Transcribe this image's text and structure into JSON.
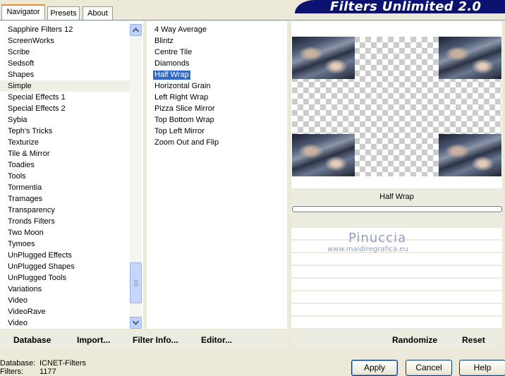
{
  "tabs": [
    "Navigator",
    "Presets",
    "About"
  ],
  "banner_title": "Filters Unlimited 2.0",
  "categories": [
    "Sapphire Filters 12",
    "ScreenWorks",
    "Scribe",
    "Sedsoft",
    "Shapes",
    "Simple",
    "Special Effects 1",
    "Special Effects 2",
    "Sybia",
    "Teph's Tricks",
    "Texturize",
    "Tile & Mirror",
    "Toadies",
    "Tools",
    "Tormentia",
    "Tramages",
    "Transparency",
    "Tronds Filters",
    "Two Moon",
    "Tymoes",
    "UnPlugged Effects",
    "UnPlugged Shapes",
    "UnPlugged Tools",
    "Variations",
    "Video",
    "VideoRave",
    "Video"
  ],
  "current_category": "Simple",
  "filters": [
    "4 Way Average",
    "Blintz",
    "Centre Tile",
    "Diamonds",
    "Half Wrap",
    "Horizontal Grain",
    "Left Right Wrap",
    "Pizza Slice Mirror",
    "Top Bottom Wrap",
    "Top Left Mirror",
    "Zoom Out and Flip"
  ],
  "selected_filter": "Half Wrap",
  "preview": {
    "filter_name": "Half Wrap",
    "progress": 0.0,
    "watermark_name": "Pinuccia",
    "watermark_url": "www.maidiregrafica.eu"
  },
  "left_actions": {
    "database": "Database",
    "import": "Import...",
    "filter_info": "Filter Info...",
    "editor": "Editor..."
  },
  "right_actions": {
    "randomize": "Randomize",
    "reset": "Reset"
  },
  "status": {
    "database_label": "Database:",
    "database_value": "ICNET-Filters",
    "filters_label": "Filters:",
    "filters_value": "1177"
  },
  "buttons": {
    "apply": "Apply",
    "cancel": "Cancel",
    "help": "Help"
  },
  "colors": {
    "banner": "#0c1270",
    "selection": "#316ac5",
    "tab_accent": "#e68b2c"
  }
}
